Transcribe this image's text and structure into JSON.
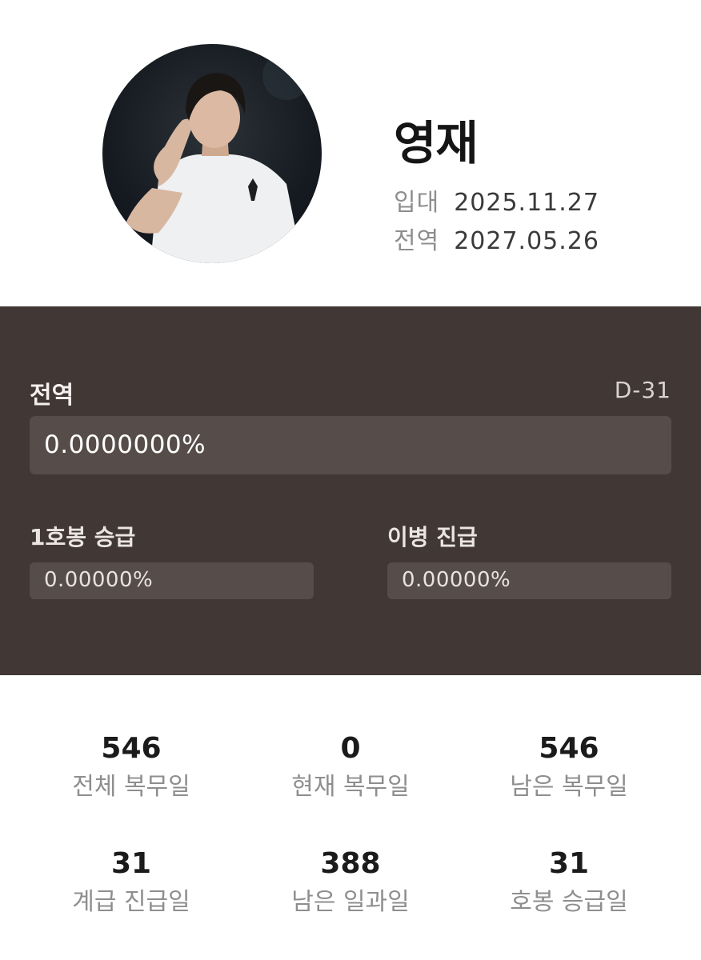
{
  "profile": {
    "name": "영재",
    "enlist_label": "입대",
    "enlist_date": "2025.11.27",
    "discharge_label": "전역",
    "discharge_date": "2027.05.26"
  },
  "progress": {
    "main": {
      "label": "전역",
      "dday": "D-31",
      "value_text": "0.0000000%",
      "fraction": 0
    },
    "sub": [
      {
        "label": "1호봉 승급",
        "value_text": "0.00000%",
        "fraction": 0
      },
      {
        "label": "이병 진급",
        "value_text": "0.00000%",
        "fraction": 0
      }
    ]
  },
  "stats": [
    {
      "value": "546",
      "label": "전체 복무일"
    },
    {
      "value": "0",
      "label": "현재 복무일"
    },
    {
      "value": "546",
      "label": "남은 복무일"
    },
    {
      "value": "31",
      "label": "계급 진급일"
    },
    {
      "value": "388",
      "label": "남은 일과일"
    },
    {
      "value": "31",
      "label": "호봉 승급일"
    }
  ],
  "colors": {
    "panel_bg": "#413735",
    "bar_bg": "#564c4a",
    "muted_text": "#8e8e8e"
  }
}
